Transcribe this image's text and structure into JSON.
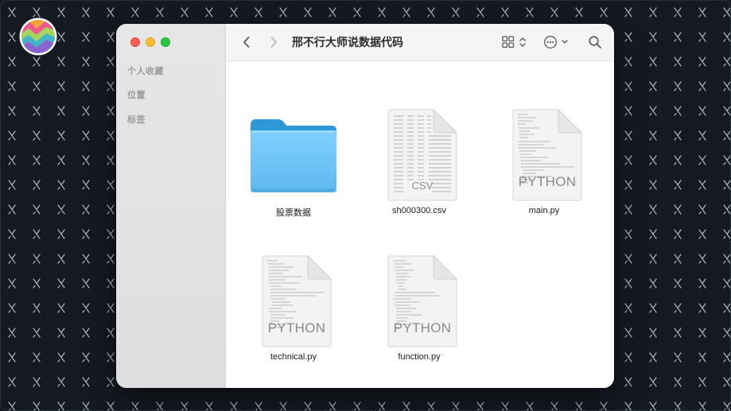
{
  "window": {
    "title": "邢不行大师说数据代码"
  },
  "sidebar": {
    "sections": [
      {
        "label": "个人收藏"
      },
      {
        "label": "位置"
      },
      {
        "label": "标签"
      }
    ]
  },
  "toolbar": {
    "back_icon": "chevron-left-icon",
    "forward_icon": "chevron-right-icon",
    "view_icon": "grid-view-icon",
    "more_icon": "ellipsis-circle-icon",
    "search_icon": "search-icon"
  },
  "files": [
    {
      "name": "股票数据",
      "kind": "folder"
    },
    {
      "name": "sh000300.csv",
      "kind": "document",
      "badge": "CSV"
    },
    {
      "name": "main.py",
      "kind": "document",
      "badge": "PYTHON"
    },
    {
      "name": "technical.py",
      "kind": "document",
      "badge": "PYTHON"
    },
    {
      "name": "function.py",
      "kind": "document",
      "badge": "PYTHON"
    }
  ],
  "colors": {
    "folder": "#6ec6f5",
    "close": "#fe5f57",
    "minimize": "#febc2e",
    "zoom": "#28c840"
  }
}
